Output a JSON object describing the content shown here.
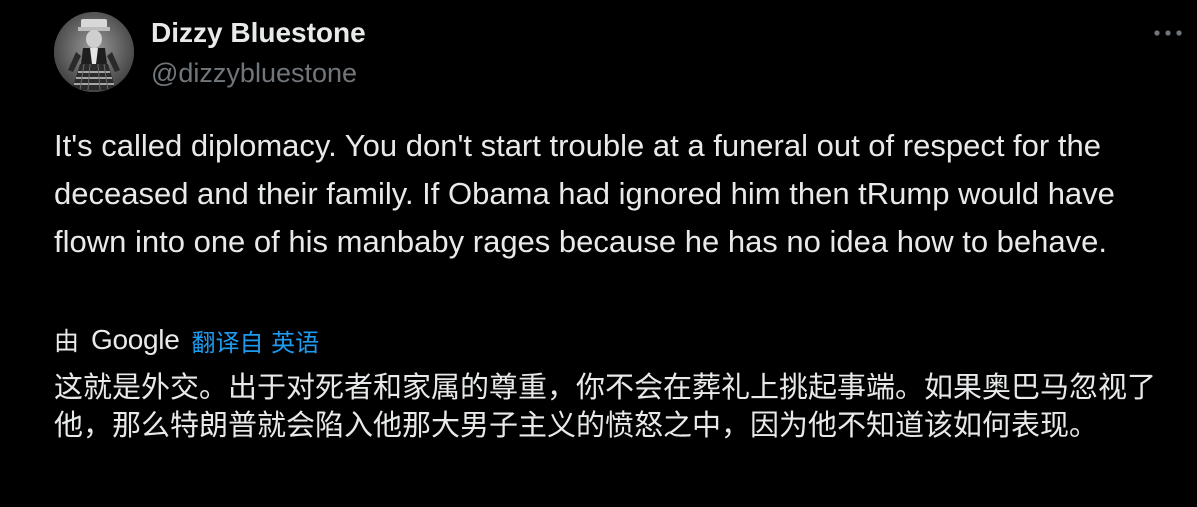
{
  "author": {
    "display_name": "Dizzy Bluestone",
    "handle": "@dizzybluestone",
    "avatar_icon": "vintage-portrait-avatar"
  },
  "tweet": {
    "text": "It's called diplomacy. You don't start trouble at a funeral out of respect for the deceased and their family. If Obama had ignored him then tRump would have flown into one of his manbaby rages because he has no idea how to behave."
  },
  "translation": {
    "by_label": "由",
    "provider": "Google",
    "source_label": "翻译自 英语",
    "text": "这就是外交。出于对死者和家属的尊重，你不会在葬礼上挑起事端。如果奥巴马忽视了他，那么特朗普就会陷入他那大男子主义的愤怒之中，因为他不知道该如何表现。"
  },
  "controls": {
    "more_icon": "more-horizontal-icon"
  },
  "colors": {
    "background": "#000000",
    "text_primary": "#e7e9ea",
    "text_secondary": "#71767b",
    "link": "#1d9bf0"
  }
}
